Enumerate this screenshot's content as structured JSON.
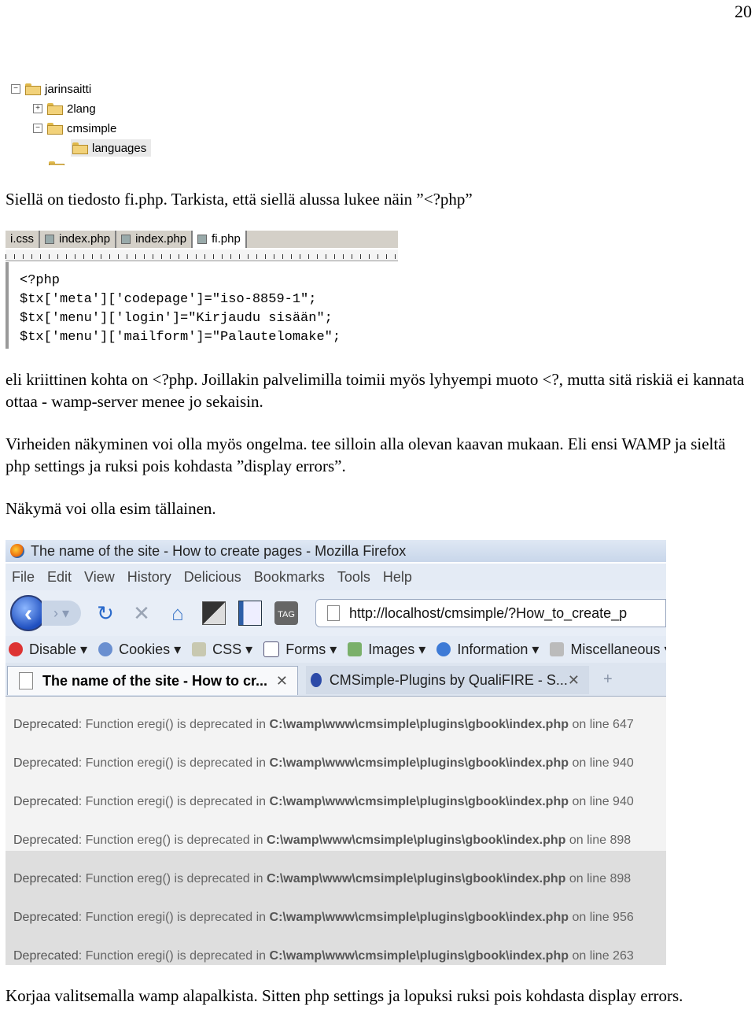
{
  "page_number": "20",
  "tree": [
    {
      "toggle": "−",
      "label": "jarinsaitti"
    },
    {
      "toggle": "+",
      "label": "2lang"
    },
    {
      "toggle": "−",
      "label": "cmsimple"
    },
    {
      "toggle": "",
      "label": "languages"
    }
  ],
  "para1": "Siellä on tiedosto fi.php. Tarkista, että siellä alussa lukee näin ”<?php”",
  "editor": {
    "tabs": [
      "i.css",
      "index.php",
      "index.php",
      "fi.php"
    ],
    "code": [
      "<?php",
      "$tx['meta']['codepage']=\"iso-8859-1\";",
      "$tx['menu']['login']=\"Kirjaudu sisään\";",
      "$tx['menu']['mailform']=\"Palautelomake\";"
    ]
  },
  "para2": "eli kriittinen kohta on <?php. Joillakin palvelimilla toimii myös lyhyempi muoto <?, mutta sitä riskiä ei kannata ottaa - wamp-server menee jo sekaisin.",
  "para3": "Virheiden näkyminen voi olla myös ongelma. tee silloin alla olevan kaavan mukaan. Eli ensi WAMP ja sieltä php settings ja ruksi pois kohdasta ”display errors”.",
  "para4": "Näkymä voi olla esim tällainen.",
  "browser": {
    "title": "The name of the site - How to create pages - Mozilla Firefox",
    "menu": [
      "File",
      "Edit",
      "View",
      "History",
      "Delicious",
      "Bookmarks",
      "Tools",
      "Help"
    ],
    "url": "http://localhost/cmsimple/?How_to_create_p",
    "devbar": [
      "Disable",
      "Cookies",
      "CSS",
      "Forms",
      "Images",
      "Information",
      "Miscellaneous"
    ],
    "tab_active": "The name of the site - How to cr...",
    "tab_other": "CMSimple-Plugins by QualiFIRE - S...",
    "errors": [
      {
        "label": "Deprecated",
        "msg": ": Function eregi() is deprecated in ",
        "path": "C:\\wamp\\www\\cmsimple\\plugins\\gbook\\index.php",
        "line": " on line 647"
      },
      {
        "label": "Deprecated",
        "msg": ": Function eregi() is deprecated in ",
        "path": "C:\\wamp\\www\\cmsimple\\plugins\\gbook\\index.php",
        "line": " on line 940"
      },
      {
        "label": "Deprecated",
        "msg": ": Function eregi() is deprecated in ",
        "path": "C:\\wamp\\www\\cmsimple\\plugins\\gbook\\index.php",
        "line": " on line 940"
      },
      {
        "label": "Deprecated",
        "msg": ": Function ereg() is deprecated in ",
        "path": "C:\\wamp\\www\\cmsimple\\plugins\\gbook\\index.php",
        "line": " on line 898"
      },
      {
        "label": "Deprecated",
        "msg": ": Function ereg() is deprecated in ",
        "path": "C:\\wamp\\www\\cmsimple\\plugins\\gbook\\index.php",
        "line": " on line 898"
      },
      {
        "label": "Deprecated",
        "msg": ": Function eregi() is deprecated in ",
        "path": "C:\\wamp\\www\\cmsimple\\plugins\\gbook\\index.php",
        "line": " on line 956"
      },
      {
        "label": "Deprecated",
        "msg": ": Function eregi() is deprecated in ",
        "path": "C:\\wamp\\www\\cmsimple\\plugins\\gbook\\index.php",
        "line": " on line 263"
      }
    ]
  },
  "para5": "Korjaa valitsemalla wamp alapalkista. Sitten php settings ja lopuksi ruksi pois kohdasta display errors."
}
